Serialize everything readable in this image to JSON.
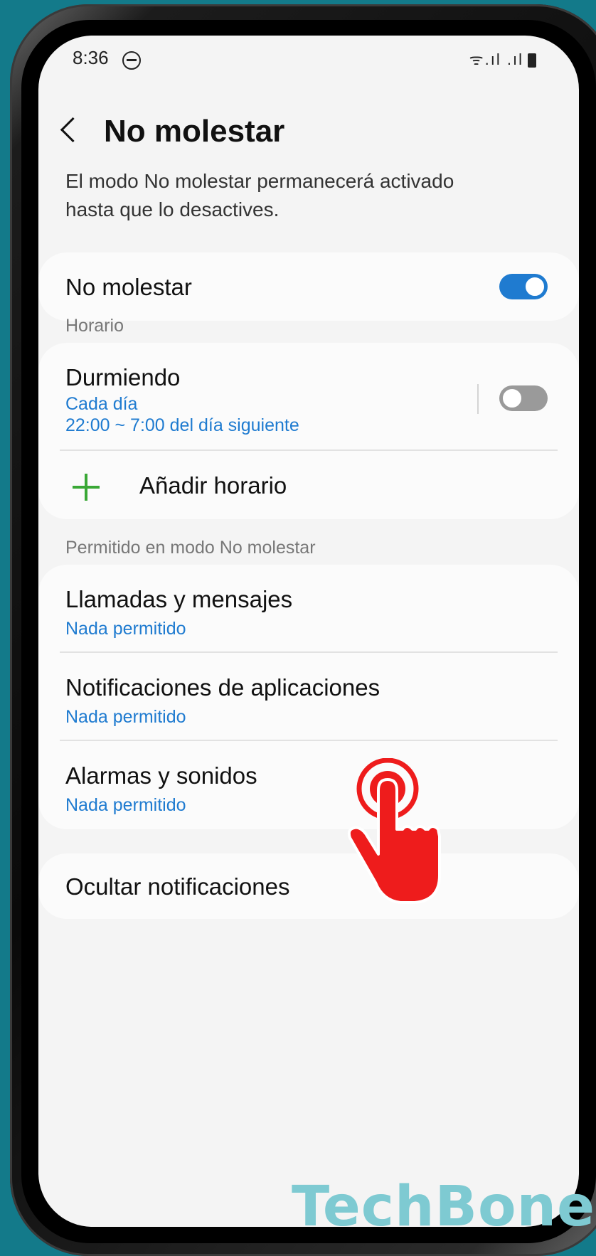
{
  "status_bar": {
    "time": "8:36",
    "icons": "ᯤ.ıl .ıl"
  },
  "header": {
    "title": "No molestar"
  },
  "description": "El modo No molestar permanecerá activado hasta que lo desactives.",
  "main_toggle": {
    "label": "No molestar",
    "enabled": true
  },
  "schedule": {
    "section_label": "Horario",
    "item": {
      "title": "Durmiendo",
      "days": "Cada día",
      "time": "22:00 ~ 7:00 del día siguiente",
      "enabled": false
    },
    "add_label": "Añadir horario"
  },
  "allowed": {
    "section_label": "Permitido en modo No molestar",
    "items": [
      {
        "title": "Llamadas y mensajes",
        "sub": "Nada permitido"
      },
      {
        "title": "Notificaciones de aplicaciones",
        "sub": "Nada permitido"
      },
      {
        "title": "Alarmas y sonidos",
        "sub": "Nada permitido"
      }
    ]
  },
  "hide_notifications": {
    "label": "Ocultar notificaciones"
  },
  "watermark": "TechBone",
  "colors": {
    "accent": "#1f7bd0",
    "background": "#137a8a",
    "plus": "#3aa836",
    "hand": "#ee1c1c"
  }
}
